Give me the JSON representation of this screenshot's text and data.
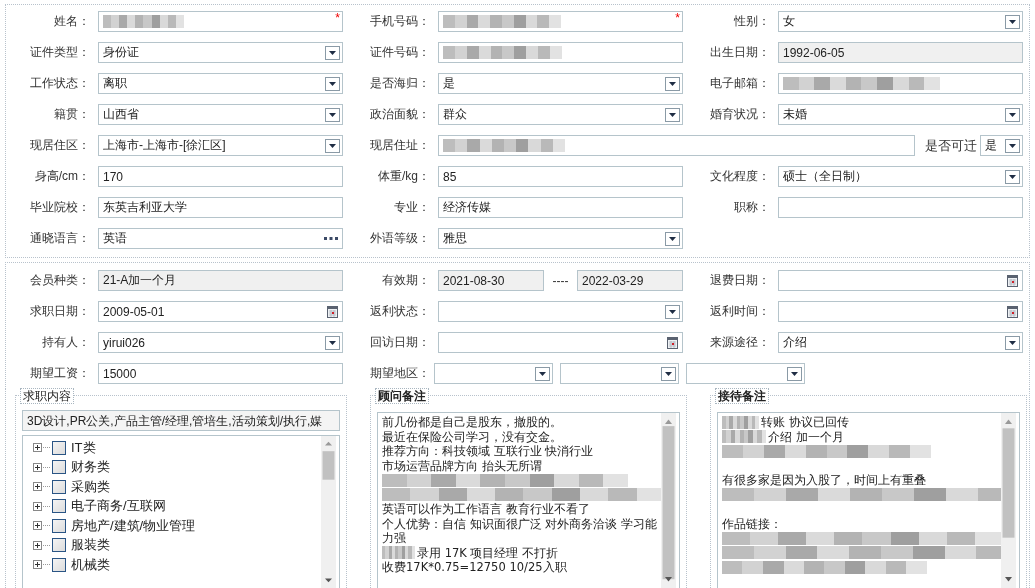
{
  "profile": {
    "rows": [
      {
        "cells": [
          {
            "label": "姓名：",
            "field": {
              "kind": "text",
              "blurred": true,
              "required_mark": "*"
            }
          },
          {
            "label": "手机号码：",
            "field": {
              "kind": "text",
              "blurred": true,
              "required_mark": "*"
            }
          },
          {
            "label": "性别：",
            "field": {
              "kind": "select",
              "value": "女"
            }
          }
        ]
      },
      {
        "cells": [
          {
            "label": "证件类型：",
            "field": {
              "kind": "select",
              "value": "身份证"
            }
          },
          {
            "label": "证件号码：",
            "field": {
              "kind": "text",
              "blurred": true
            }
          },
          {
            "label": "出生日期：",
            "field": {
              "kind": "readonly",
              "value": "1992-06-05"
            }
          }
        ]
      },
      {
        "cells": [
          {
            "label": "工作状态：",
            "field": {
              "kind": "select",
              "value": "离职"
            }
          },
          {
            "label": "是否海归：",
            "field": {
              "kind": "select",
              "value": "是"
            }
          },
          {
            "label": "电子邮箱：",
            "field": {
              "kind": "text",
              "blurred": true
            }
          }
        ]
      },
      {
        "cells": [
          {
            "label": "籍贯：",
            "field": {
              "kind": "select",
              "value": "山西省"
            }
          },
          {
            "label": "政治面貌：",
            "field": {
              "kind": "select",
              "value": "群众"
            }
          },
          {
            "label": "婚育状况：",
            "field": {
              "kind": "select",
              "value": "未婚"
            }
          }
        ]
      },
      {
        "cells": [
          {
            "label": "现居住区：",
            "field": {
              "kind": "select",
              "value": "上海市-上海市-[徐汇区]"
            }
          },
          {
            "label": "现居住址：",
            "field": {
              "kind": "text",
              "blurred": true
            },
            "extra": {
              "label": "是否可迁",
              "field": {
                "kind": "select",
                "value": "是"
              }
            }
          }
        ]
      },
      {
        "cells": [
          {
            "label": "身高/cm：",
            "field": {
              "kind": "text",
              "value": "170"
            }
          },
          {
            "label": "体重/kg：",
            "field": {
              "kind": "text",
              "value": "85"
            }
          },
          {
            "label": "文化程度：",
            "field": {
              "kind": "select",
              "value": "硕士（全日制）"
            }
          }
        ]
      },
      {
        "cells": [
          {
            "label": "毕业院校：",
            "field": {
              "kind": "text",
              "value": "东英吉利亚大学"
            }
          },
          {
            "label": "专业：",
            "field": {
              "kind": "text",
              "value": "经济传媒"
            }
          },
          {
            "label": "职称：",
            "field": {
              "kind": "text"
            }
          }
        ]
      },
      {
        "cells": [
          {
            "label": "通晓语言：",
            "field": {
              "kind": "more",
              "value": "英语"
            }
          },
          {
            "label": "外语等级：",
            "field": {
              "kind": "select",
              "value": "雅思"
            }
          }
        ]
      }
    ]
  },
  "membership": {
    "rows": [
      {
        "cells": [
          {
            "label": "会员种类：",
            "field": {
              "kind": "readonly",
              "value": "21-A加一个月"
            }
          },
          {
            "label": "有效期：",
            "field": {
              "kind": "range",
              "from": "2021-08-30",
              "separator": "----",
              "to": "2022-03-29"
            }
          },
          {
            "label": "退费日期：",
            "field": {
              "kind": "date"
            }
          }
        ]
      },
      {
        "cells": [
          {
            "label": "求职日期：",
            "field": {
              "kind": "date",
              "value": "2009-05-01"
            }
          },
          {
            "label": "返利状态：",
            "field": {
              "kind": "select"
            }
          },
          {
            "label": "返利时间：",
            "field": {
              "kind": "date"
            }
          }
        ]
      },
      {
        "cells": [
          {
            "label": "持有人：",
            "field": {
              "kind": "select",
              "value": "yirui026"
            }
          },
          {
            "label": "回访日期：",
            "field": {
              "kind": "date"
            }
          },
          {
            "label": "来源途径：",
            "field": {
              "kind": "select",
              "value": "介绍"
            }
          }
        ]
      },
      {
        "cells": [
          {
            "label": "期望工资：",
            "field": {
              "kind": "text",
              "value": "15000"
            }
          },
          {
            "label": "期望地区：",
            "field": {
              "kind": "multi-select",
              "boxes": [
                {
                  "kind": "select"
                },
                {
                  "kind": "select"
                },
                {
                  "kind": "select"
                }
              ]
            }
          }
        ]
      }
    ]
  },
  "panels": [
    {
      "kind": "tree",
      "title": "求职内容",
      "summary": "3D设计,PR公关,产品主管/经理,管培生,活动策划/执行,媒",
      "items": [
        {
          "label": "IT类",
          "checked": false,
          "expanded": false
        },
        {
          "label": "财务类",
          "checked": false,
          "expanded": false
        },
        {
          "label": "采购类",
          "checked": false,
          "expanded": false
        },
        {
          "label": "电子商务/互联网",
          "checked": false,
          "expanded": false
        },
        {
          "label": "房地产/建筑/物业管理",
          "checked": false,
          "expanded": false
        },
        {
          "label": "服装类",
          "checked": false,
          "expanded": false
        },
        {
          "label": "机械类",
          "checked": false,
          "expanded": false
        }
      ]
    },
    {
      "kind": "notes",
      "title": "顾问备注",
      "lines": [
        {
          "kind": "text",
          "text": "前几份都是自己是股东，撤股的。"
        },
        {
          "kind": "text",
          "text": "最近在保险公司学习，没有交金。"
        },
        {
          "kind": "text",
          "text": "推荐方向：科技领域 互联行业  快消行业"
        },
        {
          "kind": "text",
          "text": "市场运营品牌方向  抬头无所谓"
        },
        {
          "kind": "masked"
        },
        {
          "kind": "masked"
        },
        {
          "kind": "text",
          "text": "英语可以作为工作语言  教育行业不看了"
        },
        {
          "kind": "text",
          "text": "个人优势：自信 知识面很广泛 对外商务洽谈 学习能力强"
        },
        {
          "kind": "masked-prefix",
          "text": "录用  17K  项目经理  不打折"
        },
        {
          "kind": "text",
          "text": "收费17K*0.75=12750  10/25入职"
        }
      ]
    },
    {
      "kind": "notes",
      "title": "接待备注",
      "lines": [
        {
          "kind": "masked-prefix",
          "text": "转账 协议已回传"
        },
        {
          "kind": "masked-prefix",
          "text": "介绍 加一个月"
        },
        {
          "kind": "masked"
        },
        {
          "kind": "blank"
        },
        {
          "kind": "text",
          "text": "有很多家是因为入股了，时间上有重叠"
        },
        {
          "kind": "masked"
        },
        {
          "kind": "blank"
        },
        {
          "kind": "text",
          "text": "作品链接："
        },
        {
          "kind": "masked"
        },
        {
          "kind": "masked"
        },
        {
          "kind": "masked"
        }
      ]
    }
  ]
}
